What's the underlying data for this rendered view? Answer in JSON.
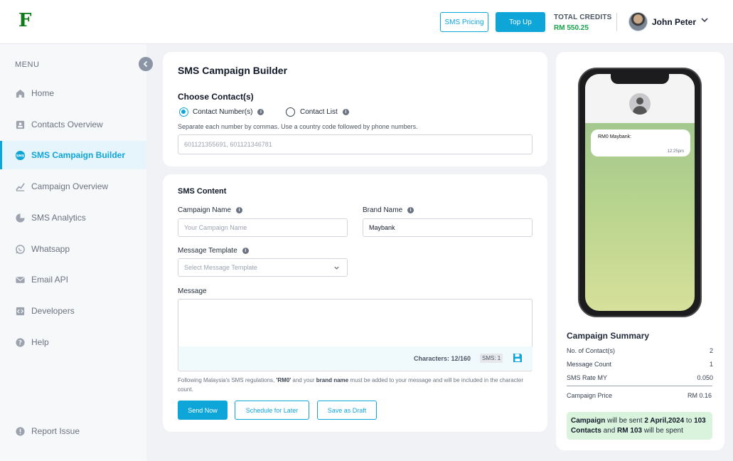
{
  "header": {
    "logo": "F",
    "sms_pricing": "SMS Pricing",
    "top_up": "Top Up",
    "credits_label": "TOTAL CREDITS",
    "credits_value": "RM 550.25",
    "user_name": "John Peter",
    "chevron": "⌄"
  },
  "sidebar": {
    "menu_label": "MENU",
    "collapse": "‹",
    "items": [
      {
        "label": "Home",
        "icon": "home-icon"
      },
      {
        "label": "Contacts Overview",
        "icon": "contacts-icon"
      },
      {
        "label": "SMS Campaign Builder",
        "icon": "sms-icon",
        "active": true
      },
      {
        "label": "Campaign Overview",
        "icon": "chart-icon"
      },
      {
        "label": "SMS  Analytics",
        "icon": "pie-chart-icon"
      },
      {
        "label": "Whatsapp",
        "icon": "whatsapp-icon"
      },
      {
        "label": "Email API",
        "icon": "email-icon"
      },
      {
        "label": "Developers",
        "icon": "code-icon"
      },
      {
        "label": "Help",
        "icon": "help-icon"
      }
    ],
    "report_issue": "Report Issue"
  },
  "builder": {
    "title": "SMS Campaign Builder",
    "choose_contacts": "Choose Contact(s)",
    "option_numbers": "Contact Number(s)",
    "option_list": "Contact List",
    "helper": "Separate each number by commas. Use a country code followed by phone numbers.",
    "numbers_placeholder": "601121355691, 601121346781"
  },
  "content": {
    "title": "SMS Content",
    "campaign_name_label": "Campaign Name",
    "campaign_name_placeholder": "Your Campaign Name",
    "brand_name_label": "Brand Name",
    "brand_name_value": "Maybank",
    "template_label": "Message Template",
    "template_placeholder": "Select Message Template",
    "message_label": "Message",
    "characters": "Characters: 12/160",
    "sms_count": "SMS: 1",
    "note_1": "Following Malaysia's SMS regulations, ",
    "note_rm0": "'RM0'",
    "note_2": " and your ",
    "note_brand": "brand name",
    "note_3": " must be added to your message and will be included in the character count.",
    "send_now": "Send Now",
    "schedule": "Schedule for Later",
    "save_draft": "Save as Draft"
  },
  "preview": {
    "bubble_text": "RM0 Maybank:",
    "bubble_time": "12:25pm"
  },
  "summary": {
    "title": "Campaign Summary",
    "rows": [
      {
        "label": "No. of Contact(s)",
        "value": "2"
      },
      {
        "label": "Message Count",
        "value": "1"
      },
      {
        "label": "SMS Rate MY",
        "value": "0.050"
      }
    ],
    "price_label": "Campaign Price",
    "price_value": "RM  0.16",
    "box_campaign": "Campaign",
    "box_1": " will be sent ",
    "box_date": "2 April,2024",
    "box_2": " to ",
    "box_contacts": "103 Contacts",
    "box_3": " and ",
    "box_amount": "RM 103",
    "box_4": " will be spent"
  },
  "colors": {
    "accent": "#0ea5d9",
    "brand_green": "#0f7a1a",
    "credits_green": "#16a34a",
    "summary_box": "#d9f3dd"
  }
}
